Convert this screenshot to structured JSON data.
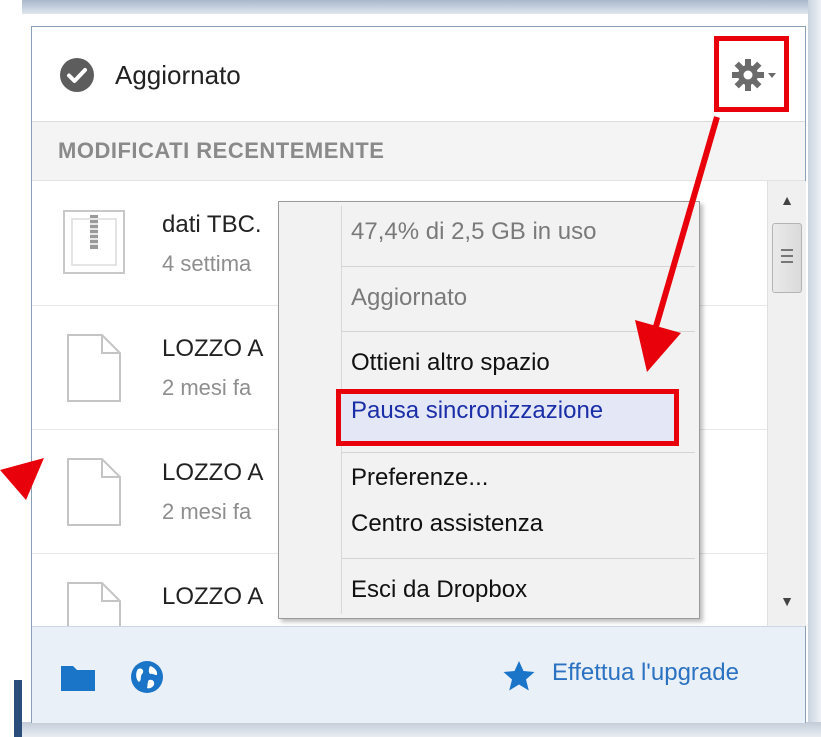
{
  "header": {
    "status": "Aggiornato"
  },
  "section": {
    "title": "MODIFICATI RECENTEMENTE"
  },
  "files": [
    {
      "name": "dati TBC.",
      "date": "4 settima",
      "icon": "zip-file-icon"
    },
    {
      "name": "LOZZO A",
      "date": "2 mesi fa",
      "icon": "file-icon"
    },
    {
      "name": "LOZZO A",
      "date": "2 mesi fa",
      "icon": "file-icon"
    },
    {
      "name": "LOZZO A",
      "date": "",
      "icon": "file-icon"
    }
  ],
  "menu": {
    "usage": "47,4% di 2,5 GB in uso",
    "status": "Aggiornato",
    "get_space": "Ottieni altro spazio",
    "pause_sync": "Pausa sincronizzazione",
    "preferences": "Preferenze...",
    "help_center": "Centro assistenza",
    "quit": "Esci da Dropbox"
  },
  "footer": {
    "upgrade": "Effettua l'upgrade"
  },
  "colors": {
    "accent": "#2b72c2",
    "highlight": "#e8000b"
  }
}
